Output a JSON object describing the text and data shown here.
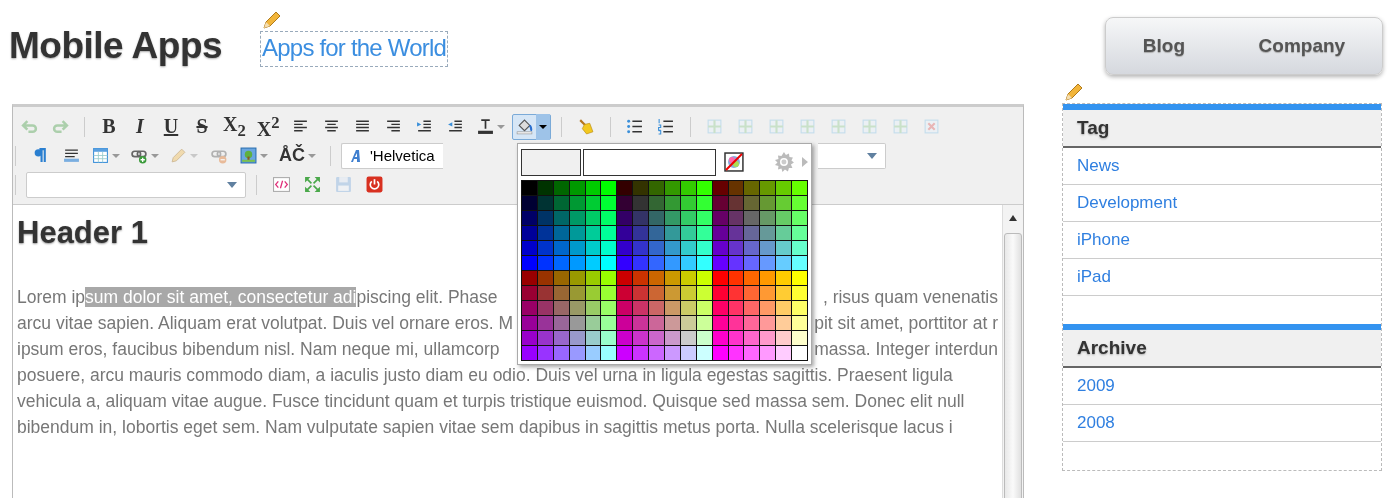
{
  "header": {
    "site_title": "Mobile Apps",
    "tagline": "Apps for the World"
  },
  "nav": [
    {
      "label": "Blog"
    },
    {
      "label": "Company"
    }
  ],
  "toolbar": {
    "rows": [
      [
        [
          {
            "kind": "undo",
            "disabled": true
          },
          {
            "kind": "redo",
            "disabled": true
          }
        ],
        [
          {
            "kind": "bold",
            "label": "B",
            "disabled": false
          },
          {
            "kind": "italic",
            "label": "I",
            "disabled": false
          },
          {
            "kind": "underline",
            "label": "U",
            "disabled": false
          },
          {
            "kind": "strike",
            "label": "S",
            "disabled": false
          },
          {
            "kind": "script",
            "label": "X$_{2}$",
            "disabled": false
          },
          {
            "kind": "script",
            "label": "X$^{2}$",
            "disabled": false
          },
          {
            "kind": "align-left",
            "disabled": false
          },
          {
            "kind": "align-center",
            "disabled": false
          },
          {
            "kind": "align-justify",
            "disabled": false
          },
          {
            "kind": "align-right",
            "disabled": false
          },
          {
            "kind": "indent",
            "disabled": false
          },
          {
            "kind": "outdent",
            "disabled": false
          },
          {
            "kind": "text-color",
            "disabled": false,
            "dropdown": true
          },
          {
            "kind": "fill",
            "disabled": false,
            "dropdown": true,
            "pressed": true
          }
        ],
        [
          {
            "kind": "broom",
            "disabled": false
          }
        ],
        [
          {
            "kind": "bullets",
            "disabled": false
          },
          {
            "kind": "numbers",
            "disabled": false
          }
        ],
        [
          {
            "kind": "table-cell",
            "disabled": true
          },
          {
            "kind": "table-cell",
            "disabled": true
          },
          {
            "kind": "table-cell",
            "disabled": true
          },
          {
            "kind": "table-cell",
            "disabled": true
          },
          {
            "kind": "table-cell",
            "disabled": true
          },
          {
            "kind": "table-cell",
            "disabled": true
          },
          {
            "kind": "table-cell",
            "disabled": true
          },
          {
            "kind": "table-delete",
            "disabled": true
          }
        ]
      ],
      [
        [
          {
            "kind": "pilcrow",
            "disabled": false
          },
          {
            "kind": "rule",
            "disabled": false
          },
          {
            "kind": "table",
            "disabled": false,
            "dropdown": true
          },
          {
            "kind": "link",
            "disabled": false,
            "dropdown": true
          },
          {
            "kind": "pencil",
            "disabled": true,
            "dropdown": true
          },
          {
            "kind": "unlink",
            "disabled": true
          },
          {
            "kind": "image",
            "disabled": false,
            "dropdown": true
          },
          {
            "kind": "chars",
            "label": "ÅČ",
            "disabled": false,
            "dropdown": true
          }
        ],
        [
          {
            "kind": "font-field",
            "value": "'Helvetica"
          },
          {
            "kind": "size-field"
          }
        ]
      ],
      [
        [
          {
            "kind": "format-field"
          }
        ],
        [
          {
            "kind": "source",
            "disabled": false
          },
          {
            "kind": "fullscreen",
            "disabled": false
          },
          {
            "kind": "save",
            "disabled": true
          },
          {
            "kind": "power",
            "disabled": false
          }
        ]
      ]
    ]
  },
  "palette": {
    "swatches": [
      [
        {
          "color": "#000000"
        },
        {
          "color": "#003300"
        },
        {
          "color": "#006600"
        },
        {
          "color": "#009900"
        },
        {
          "color": "#00cc00"
        },
        {
          "color": "#00ff00"
        },
        {
          "color": "#330000"
        },
        {
          "color": "#333300"
        },
        {
          "color": "#336600"
        },
        {
          "color": "#339900"
        },
        {
          "color": "#33cc00"
        },
        {
          "color": "#33ff00"
        },
        {
          "color": "#660000"
        },
        {
          "color": "#663300"
        },
        {
          "color": "#666600"
        },
        {
          "color": "#669900"
        },
        {
          "color": "#66cc00"
        },
        {
          "color": "#66ff00"
        }
      ],
      [
        {
          "color": "#000033"
        },
        {
          "color": "#003333"
        },
        {
          "color": "#006633"
        },
        {
          "color": "#009933"
        },
        {
          "color": "#00cc33"
        },
        {
          "color": "#00ff33"
        },
        {
          "color": "#330033"
        },
        {
          "color": "#333333"
        },
        {
          "color": "#336633"
        },
        {
          "color": "#339933"
        },
        {
          "color": "#33cc33"
        },
        {
          "color": "#33ff33"
        },
        {
          "color": "#660033"
        },
        {
          "color": "#663333"
        },
        {
          "color": "#666633"
        },
        {
          "color": "#669933"
        },
        {
          "color": "#66cc33"
        },
        {
          "color": "#66ff33"
        }
      ],
      [
        {
          "color": "#000066"
        },
        {
          "color": "#003366"
        },
        {
          "color": "#006666"
        },
        {
          "color": "#009966"
        },
        {
          "color": "#00cc66"
        },
        {
          "color": "#00ff66"
        },
        {
          "color": "#330066"
        },
        {
          "color": "#333366"
        },
        {
          "color": "#336666"
        },
        {
          "color": "#339966"
        },
        {
          "color": "#33cc66"
        },
        {
          "color": "#33ff66"
        },
        {
          "color": "#660066"
        },
        {
          "color": "#663366"
        },
        {
          "color": "#666666"
        },
        {
          "color": "#669966"
        },
        {
          "color": "#66cc66"
        },
        {
          "color": "#66ff66"
        }
      ],
      [
        {
          "color": "#000099"
        },
        {
          "color": "#003399"
        },
        {
          "color": "#006699"
        },
        {
          "color": "#009999"
        },
        {
          "color": "#00cc99"
        },
        {
          "color": "#00ff99"
        },
        {
          "color": "#330099"
        },
        {
          "color": "#333399"
        },
        {
          "color": "#336699"
        },
        {
          "color": "#339999"
        },
        {
          "color": "#33cc99"
        },
        {
          "color": "#33ff99"
        },
        {
          "color": "#660099"
        },
        {
          "color": "#663399"
        },
        {
          "color": "#666699"
        },
        {
          "color": "#669999"
        },
        {
          "color": "#66cc99"
        },
        {
          "color": "#66ff99"
        }
      ],
      [
        {
          "color": "#0000cc"
        },
        {
          "color": "#0033cc"
        },
        {
          "color": "#0066cc"
        },
        {
          "color": "#0099cc"
        },
        {
          "color": "#00cccc"
        },
        {
          "color": "#00ffcc"
        },
        {
          "color": "#3300cc"
        },
        {
          "color": "#3333cc"
        },
        {
          "color": "#3366cc"
        },
        {
          "color": "#3399cc"
        },
        {
          "color": "#33cccc"
        },
        {
          "color": "#33ffcc"
        },
        {
          "color": "#6600cc"
        },
        {
          "color": "#6633cc"
        },
        {
          "color": "#6666cc"
        },
        {
          "color": "#6699cc"
        },
        {
          "color": "#66cccc"
        },
        {
          "color": "#66ffcc"
        }
      ],
      [
        {
          "color": "#0000ff"
        },
        {
          "color": "#0033ff"
        },
        {
          "color": "#0066ff"
        },
        {
          "color": "#0099ff"
        },
        {
          "color": "#00ccff"
        },
        {
          "color": "#00ffff"
        },
        {
          "color": "#3300ff"
        },
        {
          "color": "#3333ff"
        },
        {
          "color": "#3366ff"
        },
        {
          "color": "#3399ff"
        },
        {
          "color": "#33ccff"
        },
        {
          "color": "#33ffff"
        },
        {
          "color": "#6600ff"
        },
        {
          "color": "#6633ff"
        },
        {
          "color": "#6666ff"
        },
        {
          "color": "#6699ff"
        },
        {
          "color": "#66ccff"
        },
        {
          "color": "#66ffff"
        }
      ],
      [
        {
          "color": "#990000"
        },
        {
          "color": "#993300"
        },
        {
          "color": "#996600"
        },
        {
          "color": "#999900"
        },
        {
          "color": "#99cc00"
        },
        {
          "color": "#99ff00"
        },
        {
          "color": "#cc0000"
        },
        {
          "color": "#cc3300"
        },
        {
          "color": "#cc6600"
        },
        {
          "color": "#cc9900"
        },
        {
          "color": "#cccc00"
        },
        {
          "color": "#ccff00"
        },
        {
          "color": "#ff0000"
        },
        {
          "color": "#ff3300"
        },
        {
          "color": "#ff6600"
        },
        {
          "color": "#ff9900"
        },
        {
          "color": "#ffcc00"
        },
        {
          "color": "#ffff00"
        }
      ],
      [
        {
          "color": "#990033"
        },
        {
          "color": "#993333"
        },
        {
          "color": "#996633"
        },
        {
          "color": "#999933"
        },
        {
          "color": "#99cc33"
        },
        {
          "color": "#99ff33"
        },
        {
          "color": "#cc0033"
        },
        {
          "color": "#cc3333"
        },
        {
          "color": "#cc6633"
        },
        {
          "color": "#cc9933"
        },
        {
          "color": "#cccc33"
        },
        {
          "color": "#ccff33"
        },
        {
          "color": "#ff0033"
        },
        {
          "color": "#ff3333"
        },
        {
          "color": "#ff6633"
        },
        {
          "color": "#ff9933"
        },
        {
          "color": "#ffcc33"
        },
        {
          "color": "#ffff33"
        }
      ],
      [
        {
          "color": "#990066"
        },
        {
          "color": "#993366"
        },
        {
          "color": "#996666"
        },
        {
          "color": "#999966"
        },
        {
          "color": "#99cc66"
        },
        {
          "color": "#99ff66"
        },
        {
          "color": "#cc0066"
        },
        {
          "color": "#cc3366"
        },
        {
          "color": "#cc6666"
        },
        {
          "color": "#cc9966"
        },
        {
          "color": "#cccc66"
        },
        {
          "color": "#ccff66"
        },
        {
          "color": "#ff0066"
        },
        {
          "color": "#ff3366"
        },
        {
          "color": "#ff6666"
        },
        {
          "color": "#ff9966"
        },
        {
          "color": "#ffcc66"
        },
        {
          "color": "#ffff66"
        }
      ],
      [
        {
          "color": "#990099"
        },
        {
          "color": "#993399"
        },
        {
          "color": "#996699"
        },
        {
          "color": "#999999"
        },
        {
          "color": "#99cc99"
        },
        {
          "color": "#99ff99"
        },
        {
          "color": "#cc0099"
        },
        {
          "color": "#cc3399"
        },
        {
          "color": "#cc6699"
        },
        {
          "color": "#cc9999"
        },
        {
          "color": "#cccc99"
        },
        {
          "color": "#ccff99"
        },
        {
          "color": "#ff0099"
        },
        {
          "color": "#ff3399"
        },
        {
          "color": "#ff6699"
        },
        {
          "color": "#ff9999"
        },
        {
          "color": "#ffcc99"
        },
        {
          "color": "#ffff99"
        }
      ],
      [
        {
          "color": "#9900cc"
        },
        {
          "color": "#9933cc"
        },
        {
          "color": "#9966cc"
        },
        {
          "color": "#9999cc"
        },
        {
          "color": "#99cccc"
        },
        {
          "color": "#99ffcc"
        },
        {
          "color": "#cc00cc"
        },
        {
          "color": "#cc33cc"
        },
        {
          "color": "#cc66cc"
        },
        {
          "color": "#cc99cc"
        },
        {
          "color": "#cccccc"
        },
        {
          "color": "#ccffcc"
        },
        {
          "color": "#ff00cc"
        },
        {
          "color": "#ff33cc"
        },
        {
          "color": "#ff66cc"
        },
        {
          "color": "#ff99cc"
        },
        {
          "color": "#ffcccc"
        },
        {
          "color": "#ffffcc"
        }
      ],
      [
        {
          "color": "#9900ff"
        },
        {
          "color": "#9933ff"
        },
        {
          "color": "#9966ff"
        },
        {
          "color": "#9999ff"
        },
        {
          "color": "#99ccff"
        },
        {
          "color": "#99ffff"
        },
        {
          "color": "#cc00ff"
        },
        {
          "color": "#cc33ff"
        },
        {
          "color": "#cc66ff"
        },
        {
          "color": "#cc99ff"
        },
        {
          "color": "#ccccff"
        },
        {
          "color": "#ccffff"
        },
        {
          "color": "#ff00ff"
        },
        {
          "color": "#ff33ff"
        },
        {
          "color": "#ff66ff"
        },
        {
          "color": "#ff99ff"
        },
        {
          "color": "#ffccff"
        },
        {
          "color": "#ffffff"
        }
      ]
    ]
  },
  "content": {
    "heading": "Header 1",
    "lines": [
      {
        "left": [
          {
            "text": "Lorem ip",
            "selected": false
          },
          {
            "text": "sum dolor sit amet, consectetur adi",
            "selected": true
          },
          {
            "text": "piscing elit. Phase",
            "selected": false
          }
        ],
        "right": ", risus quam venenatis"
      },
      {
        "left": [
          {
            "text": "arcu vitae sapien. Aliquam erat volutpat. Duis vel ornare eros. M",
            "selected": false
          }
        ],
        "right": "pit sit amet, porttitor at r"
      },
      {
        "left": [
          {
            "text": "ipsum eros, faucibus bibendum nisl. Nam neque mi, ullamcorp",
            "selected": false
          }
        ],
        "right": "massa. Integer interdun"
      },
      {
        "left": [
          {
            "text": "posuere, arcu mauris commodo diam, a iaculis justo diam eu odio. Duis vel urna in ligula egestas sagittis. Praesent ligula",
            "selected": false
          }
        ]
      },
      {
        "left": [
          {
            "text": "vehicula a, aliquam vitae augue. Fusce tincidunt quam et turpis tristique euismod. Quisque sed massa sem. Donec elit null",
            "selected": false
          }
        ]
      },
      {
        "left": [
          {
            "text": "bibendum in, lobortis eget sem. Nam vulputate sapien vitae sem dapibus in sagittis metus porta. Nulla scelerisque lacus i",
            "selected": false
          }
        ]
      }
    ]
  },
  "sidebar": [
    {
      "title": "Tag",
      "items": [
        "News",
        "Development",
        "iPhone",
        "iPad"
      ]
    },
    {
      "title": "Archive",
      "items": [
        "2009",
        "2008"
      ]
    }
  ]
}
